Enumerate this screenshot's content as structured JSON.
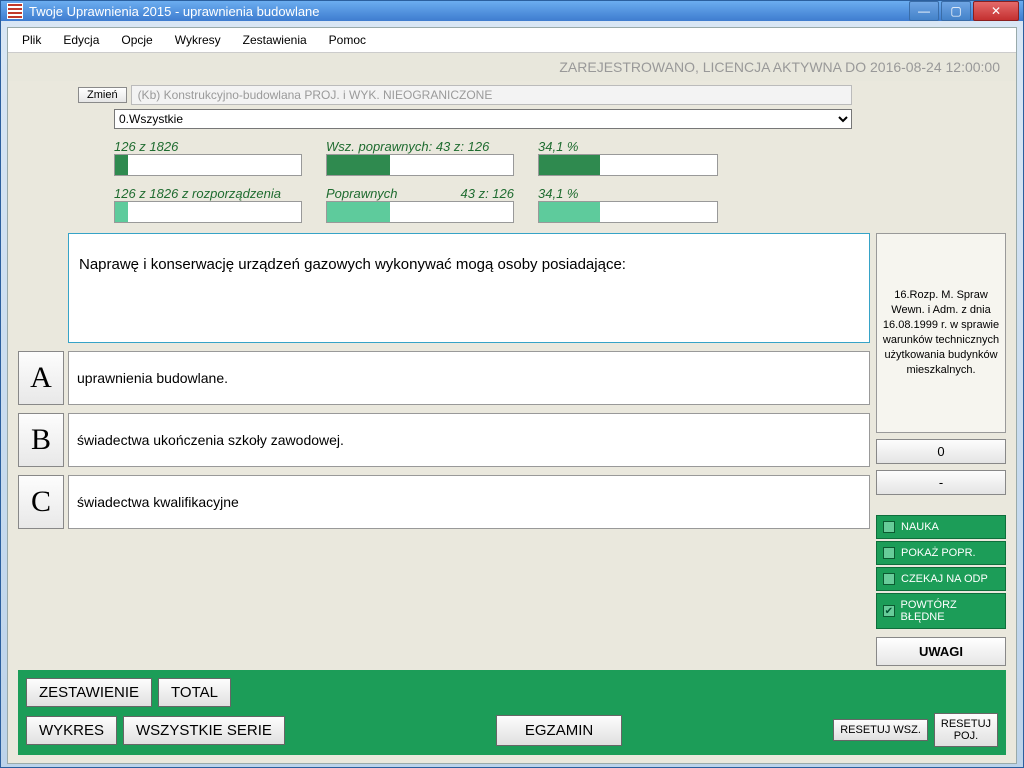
{
  "window": {
    "title": "Twoje Uprawnienia 2015 - uprawnienia budowlane"
  },
  "menu": {
    "plik": "Plik",
    "edycja": "Edycja",
    "opcje": "Opcje",
    "wykresy": "Wykresy",
    "zestawienia": "Zestawienia",
    "pomoc": "Pomoc"
  },
  "license_line": "ZAREJESTROWANO, LICENCJA AKTYWNA DO 2016-08-24 12:00:00",
  "selectors": {
    "change_btn": "Zmień",
    "category_ro": "(Kb) Konstrukcyjno-budowlana  PROJ. i WYK. NIEOGRANICZONE",
    "filter": "0.Wszystkie"
  },
  "stats": {
    "col1": {
      "top_label": "126 z 1826",
      "top_pct": 7,
      "bot_label": "126 z 1826 z rozporządzenia",
      "bot_pct": 7
    },
    "col2": {
      "top_label": "Wsz. poprawnych: 43 z: 126",
      "top_pct": 34,
      "bot_label_left": "Poprawnych",
      "bot_label_right": "43 z: 126",
      "bot_pct": 34
    },
    "col3": {
      "top_label": "34,1 %",
      "top_pct": 34,
      "bot_label": "34,1 %",
      "bot_pct": 34
    }
  },
  "reference_text": "16.Rozp. M. Spraw Wewn. i Adm. z dnia 16.08.1999 r. w sprawie warunków technicznych użytkowania budynków mieszkalnych.",
  "score": {
    "value": "0",
    "dash": "-"
  },
  "modes": {
    "nauka": "NAUKA",
    "pokaz": "POKAŻ POPR.",
    "czekaj": "CZEKAJ NA ODP",
    "powtorz": "POWTÓRZ BŁĘDNE"
  },
  "uwagi": "UWAGI",
  "question": "Naprawę i konserwację urządzeń gazowych wykonywać mogą osoby posiadające:",
  "answers": {
    "a_letter": "A",
    "a_text": "uprawnienia budowlane.",
    "b_letter": "B",
    "b_text": "świadectwa ukończenia szkoły zawodowej.",
    "c_letter": "C",
    "c_text": "świadectwa kwalifikacyjne"
  },
  "bottom": {
    "zestawienie": "ZESTAWIENIE",
    "total": "TOTAL",
    "wykres": "WYKRES",
    "wszystkie": "WSZYSTKIE SERIE",
    "egzamin": "EGZAMIN",
    "reset_all": "RESETUJ WSZ.",
    "reset_one": "RESETUJ\nPOJ."
  }
}
